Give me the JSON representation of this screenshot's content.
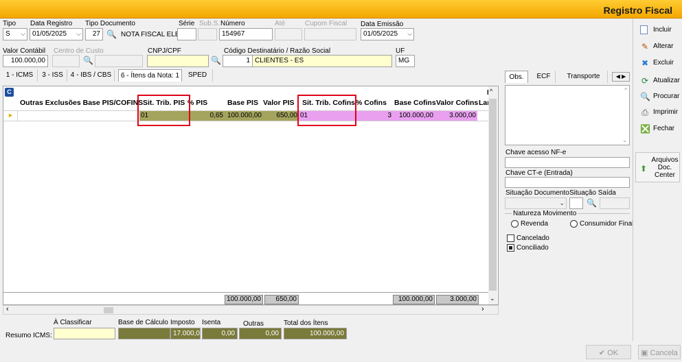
{
  "window": {
    "title": "Registro Fiscal"
  },
  "header": {
    "tipo_label": "Tipo",
    "tipo_value": "S",
    "data_registro_label": "Data Registro",
    "data_registro_value": "01/05/2025",
    "tipo_documento_label": "Tipo Documento",
    "tipo_documento_code": "27",
    "tipo_documento_name": "NOTA FISCAL ELE",
    "serie_label": "Série",
    "sub_serie_label": "Sub.S.",
    "numero_label": "Número",
    "numero_value": "154967",
    "ate_label": "Até",
    "cupom_fiscal_label": "Cupom Fiscal",
    "data_emissao_label": "Data Emissão",
    "data_emissao_value": "01/05/2025",
    "valor_contabil_label": "Valor Contábil",
    "valor_contabil_value": "100.000,00",
    "centro_custo_label": "Centro de Custo",
    "cnpj_label": "CNPJ/CPF",
    "cod_dest_label": "Código Destinatário / Razão Social",
    "cod_dest_code": "1",
    "cod_dest_name": "CLIENTES - ES",
    "uf_label": "UF",
    "uf_value": "MG"
  },
  "tabs": [
    "1 - ICMS",
    "3 - ISS",
    "4 - IBS / CBS",
    "6 - Ítens da Nota: 1",
    "SPED"
  ],
  "grid": {
    "badge": "C",
    "columns": [
      "Outras Exclusões Base PIS/COFINS",
      "Sit. Trib. PIS",
      "% PIS",
      "Base PIS",
      "Valor PIS",
      "Sit. Trib. Cofins",
      "% Cofins",
      "Base Cofins",
      "Valor Cofins",
      "Lar"
    ],
    "row": {
      "sit_trib_pis": "01",
      "pct_pis": "0,65",
      "base_pis": "100.000,00",
      "valor_pis": "650,00",
      "sit_trib_cofins": "01",
      "pct_cofins": "3",
      "base_cofins": "100.000,00",
      "valor_cofins": "3.000,00"
    },
    "totals": {
      "base_pis": "100.000,00",
      "valor_pis": "650,00",
      "base_cofins": "100.000,00",
      "valor_cofins": "3.000,00"
    }
  },
  "resumo": {
    "label": "Resumo ICMS:",
    "a_classificar_label": "À Classificar",
    "base_calculo_label": "Base de Cálculo",
    "imposto_label": "Imposto",
    "imposto_value": "17.000,00",
    "isenta_label": "Isenta",
    "isenta_value": "0,00",
    "outras_label": "Outras",
    "outras_value": "0,00",
    "total_itens_label": "Total dos Ítens",
    "total_itens_value": "100.000,00"
  },
  "right_tabs": [
    "Obs.",
    "ECF",
    "Transporte"
  ],
  "side": {
    "chave_nfe_label": "Chave acesso NF-e",
    "chave_cte_label": "Chave CT-e (Entrada)",
    "situacao_doc_label": "Situação Documento",
    "situacao_saida_label": "Situação Saída",
    "natureza_label": "Natureza Movimento",
    "revenda_label": "Revenda",
    "consumidor_label": "Consumidor Final",
    "cancelado_label": "Cancelado",
    "conciliado_label": "Conciliado"
  },
  "actions": {
    "incluir": "Incluir",
    "alterar": "Alterar",
    "excluir": "Excluir",
    "atualizar": "Atualizar",
    "procurar": "Procurar",
    "imprimir": "Imprimir",
    "fechar": "Fechar",
    "arquivos": "Arquivos Doc. Center"
  },
  "footer": {
    "ok": "OK",
    "cancelar": "Cancela"
  },
  "colors": {
    "accent": "#f3a700",
    "olive": "#a4a45e",
    "pink": "#e8a0ef",
    "highlight": "#e0001a"
  }
}
